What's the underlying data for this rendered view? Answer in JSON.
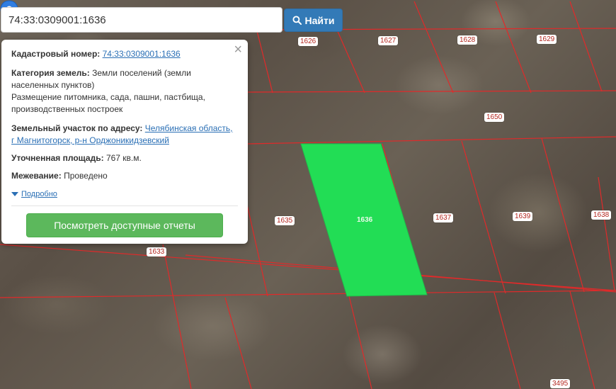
{
  "search": {
    "value": "74:33:0309001:1636",
    "button_label": "Найти"
  },
  "popup": {
    "cadastral_label": "Кадастровый номер:",
    "cadastral_value": "74:33:0309001:1636",
    "category_label": "Категория земель:",
    "category_value": "Земли поселений (земли населенных пунктов)",
    "usage_value": "Размещение питомника, сада, пашни, пастбища, производственных построек",
    "address_label": "Земельный участок по адресу:",
    "address_value": "Челябинская область, г Магнитогорск, р-н Орджоникидзевский",
    "area_label": "Уточненная площадь:",
    "area_value": "767 кв.м.",
    "survey_label": "Межевание:",
    "survey_value": "Проведено",
    "details_link": "Подробно",
    "reports_button": "Посмотреть доступные отчеты"
  },
  "map": {
    "parcel_labels": {
      "p1626": "1626",
      "p1627": "1627",
      "p1628": "1628",
      "p1629": "1629",
      "p1650": "1650",
      "p1635": "1635",
      "p1636": "1636",
      "p1637": "1637",
      "p1639": "1639",
      "p1638": "1638",
      "p1633": "1633",
      "p3495": "3495"
    },
    "boundary_color": "#e02a2a",
    "selected_parcel_color": "#22dd55",
    "marker_color": "#2f7de1"
  },
  "icons": {
    "search": "search-icon",
    "close": "close-icon",
    "marker": "map-marker-icon",
    "caret": "caret-down-icon"
  }
}
